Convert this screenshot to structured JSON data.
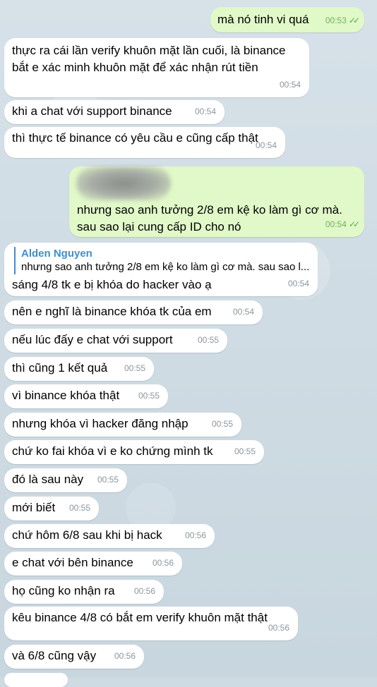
{
  "messages": [
    {
      "id": "m1",
      "dir": "out",
      "text": "mà nó tinh vi quá",
      "time": "00:53"
    },
    {
      "id": "m2",
      "dir": "in",
      "text": "thực ra cái lần verify khuôn mặt lần cuối, là binance bắt e xác minh khuôn mặt để xác nhận rút tiền",
      "time": "00:54"
    },
    {
      "id": "m3",
      "dir": "in",
      "text": "khi a chat với support binance",
      "time": "00:54"
    },
    {
      "id": "m4",
      "dir": "in",
      "text": "thì thực tế binance có yêu cầu e cũng cấp thật",
      "time": "00:54"
    },
    {
      "id": "m5",
      "dir": "out",
      "text": "nhưng sao anh tưởng 2/8 em kệ ko làm gì cơ mà. sau sao lại cung cấp ID cho nó",
      "time": "00:54"
    },
    {
      "id": "m6",
      "dir": "in",
      "reply_name": "Alden Nguyen",
      "reply_text": "nhưng sao anh tưởng 2/8 em kệ ko làm gì cơ mà. sau sao l...",
      "text": "sáng 4/8 tk e bị khóa do hacker vào ạ",
      "time": "00:54"
    },
    {
      "id": "m7",
      "dir": "in",
      "text": "nên e nghĩ là binance khóa tk của em",
      "time": "00:54"
    },
    {
      "id": "m8",
      "dir": "in",
      "text": "nếu lúc đấy e chat với support",
      "time": "00:55"
    },
    {
      "id": "m9",
      "dir": "in",
      "text": "thì cũng 1 kết quả",
      "time": "00:55"
    },
    {
      "id": "m10",
      "dir": "in",
      "text": "vì binance khóa thật",
      "time": "00:55"
    },
    {
      "id": "m11",
      "dir": "in",
      "text": "nhưng khóa vì hacker đăng nhập",
      "time": "00:55"
    },
    {
      "id": "m12",
      "dir": "in",
      "text": "chứ ko fai khóa vì e ko chứng mình tk",
      "time": "00:55"
    },
    {
      "id": "m13",
      "dir": "in",
      "text": "đó là sau này",
      "time": "00:55"
    },
    {
      "id": "m14",
      "dir": "in",
      "text": "mới biết",
      "time": "00:55"
    },
    {
      "id": "m15",
      "dir": "in",
      "text": "chứ hôm 6/8 sau khi bị hack",
      "time": "00:56"
    },
    {
      "id": "m16",
      "dir": "in",
      "text": "e chat với bên binance",
      "time": "00:56"
    },
    {
      "id": "m17",
      "dir": "in",
      "text": "họ cũng ko nhận ra",
      "time": "00:56"
    },
    {
      "id": "m18",
      "dir": "in",
      "text": "kêu binance 4/8 có bắt em verify khuôn mặt thật",
      "time": "00:56"
    },
    {
      "id": "m19",
      "dir": "in",
      "text": "và 6/8 cũng vậy",
      "time": "00:56"
    }
  ]
}
